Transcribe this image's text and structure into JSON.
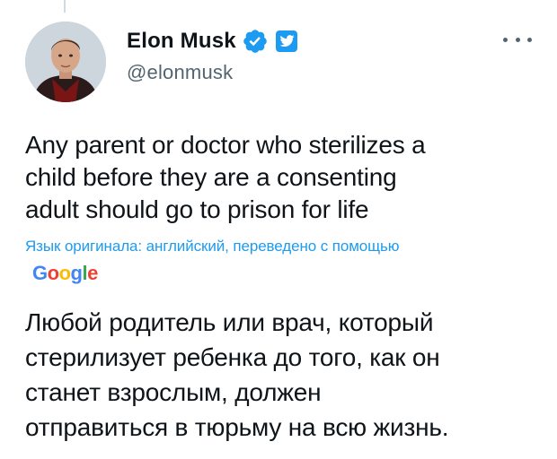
{
  "author": {
    "display_name": "Elon Musk",
    "handle": "@elonmusk",
    "verified": true
  },
  "tweet": {
    "lines": [
      "Any parent or doctor who sterilizes a",
      "child before they are a consenting",
      "adult should go to prison for life"
    ]
  },
  "translation": {
    "note": "Язык оригинала: английский, переведено с помощью",
    "provider": [
      "G",
      "o",
      "o",
      "g",
      "l",
      "e"
    ],
    "lines": [
      "Любой родитель или врач, который",
      "стерилизует ребенка до того, как он",
      "станет взрослым, должен",
      "отправиться в тюрьму на всю жизнь."
    ]
  },
  "colors": {
    "link": "#1d9bf0",
    "verified": "#1d9bf0",
    "secondary_text": "#536471"
  },
  "icons": {
    "verified": "verified-badge-icon",
    "app": "twitter-bird-icon",
    "menu": "more-horizontal-icon"
  }
}
